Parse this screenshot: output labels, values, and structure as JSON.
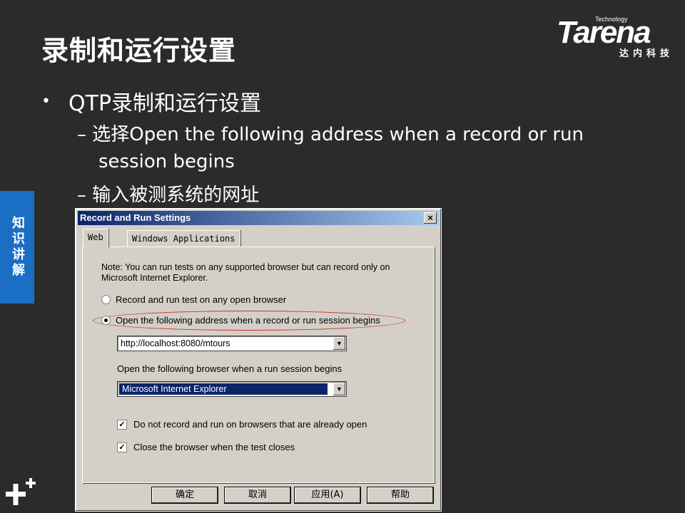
{
  "slide": {
    "title": "录制和运行设置",
    "bullet": "QTP录制和运行设置",
    "sub1": "– 选择Open the following address when a record or run",
    "sub1_cont": "session begins",
    "sub2": "– 输入被测系统的网址",
    "side_tab": "知识讲解"
  },
  "logo": {
    "tech": "Technology",
    "word": "Tarena",
    "cn": "达内科技"
  },
  "dialog": {
    "title": "Record and Run Settings",
    "close": "×",
    "tabs": [
      "Web",
      "Windows Applications"
    ],
    "note": "Note: You can run tests on any supported browser but can record only on Microsoft Internet Explorer.",
    "radio1": "Record and run test on any open browser",
    "radio2": "Open the following address when a record or run session begins",
    "address": "http://localhost:8080/mtours",
    "browser_label": "Open the following browser when a run session begins",
    "browser": "Microsoft Internet Explorer",
    "check1": "Do not record and run on browsers that are already open",
    "check2": "Close the browser when the test closes",
    "buttons": {
      "ok": "确定",
      "cancel": "取消",
      "apply": "应用(A)",
      "help": "帮助"
    }
  },
  "colors": {
    "background": "#2b2b2b",
    "side_tab": "#1a6fc4",
    "titlebar": "#0a246a"
  }
}
